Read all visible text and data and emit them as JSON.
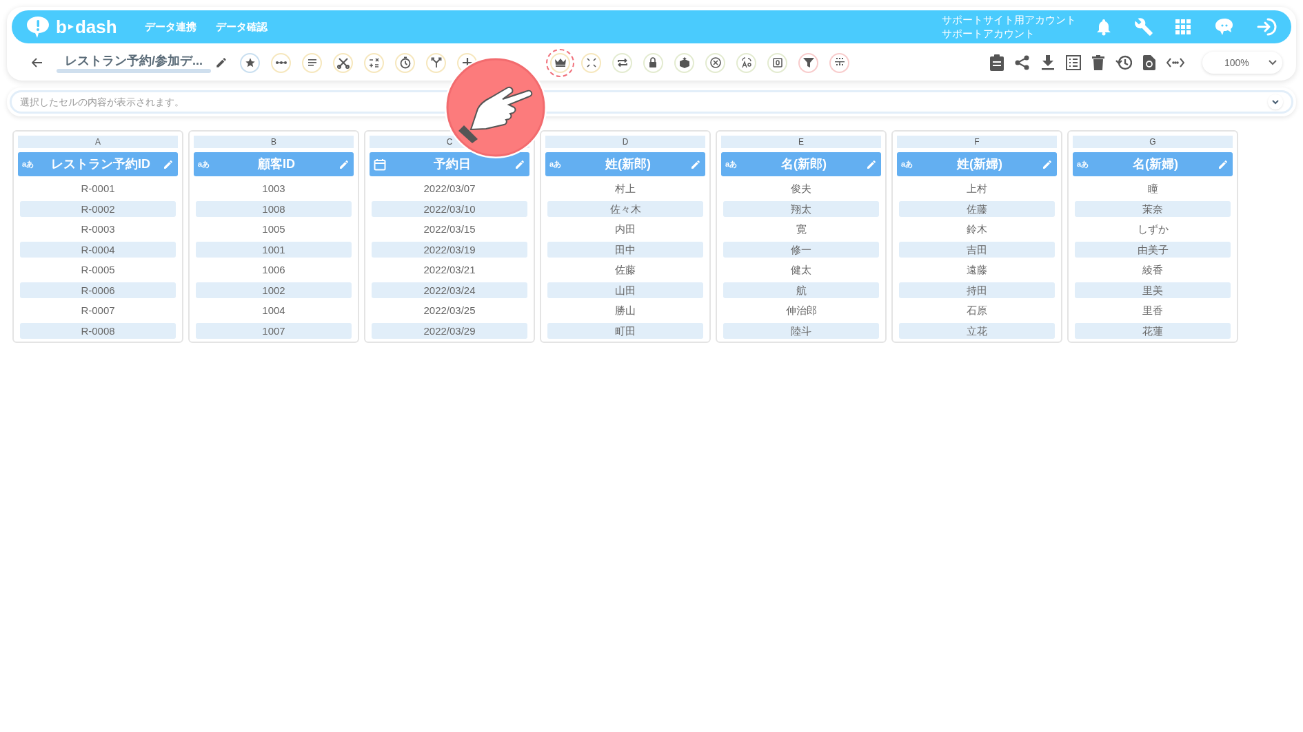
{
  "header": {
    "logo": [
      "b",
      "dash"
    ],
    "nav": [
      {
        "label": "データ連携"
      },
      {
        "label": "データ確認"
      }
    ],
    "account": [
      "サポートサイト用アカウント",
      "サポートアカウント"
    ]
  },
  "toolbar": {
    "title": "レストラン予約/参加デ...",
    "zoom": "100%"
  },
  "cell_bar": {
    "placeholder": "選択したセルの内容が表示されます。"
  },
  "columns": [
    {
      "letter": "A",
      "title": "レストラン予約ID",
      "kind": "text",
      "badge": "aあ",
      "cells": [
        "R-0001",
        "R-0002",
        "R-0003",
        "R-0004",
        "R-0005",
        "R-0006",
        "R-0007",
        "R-0008"
      ]
    },
    {
      "letter": "B",
      "title": "顧客ID",
      "kind": "text",
      "badge": "aあ",
      "cells": [
        "1003",
        "1008",
        "1005",
        "1001",
        "1006",
        "1002",
        "1004",
        "1007"
      ]
    },
    {
      "letter": "C",
      "title": "予約日",
      "kind": "date",
      "cells": [
        "2022/03/07",
        "2022/03/10",
        "2022/03/15",
        "2022/03/19",
        "2022/03/21",
        "2022/03/24",
        "2022/03/25",
        "2022/03/29"
      ]
    },
    {
      "letter": "D",
      "title": "姓(新郎)",
      "kind": "text",
      "badge": "aあ",
      "cells": [
        "村上",
        "佐々木",
        "内田",
        "田中",
        "佐藤",
        "山田",
        "勝山",
        "町田"
      ]
    },
    {
      "letter": "E",
      "title": "名(新郎)",
      "kind": "text",
      "badge": "aあ",
      "cells": [
        "俊夫",
        "翔太",
        "寛",
        "修一",
        "健太",
        "航",
        "伸治郎",
        "陸斗"
      ]
    },
    {
      "letter": "F",
      "title": "姓(新婦)",
      "kind": "text",
      "badge": "aあ",
      "cells": [
        "上村",
        "佐藤",
        "鈴木",
        "吉田",
        "遠藤",
        "持田",
        "石原",
        "立花"
      ]
    },
    {
      "letter": "G",
      "title": "名(新婦)",
      "kind": "text",
      "badge": "aあ",
      "cells": [
        "瞳",
        "茉奈",
        "しずか",
        "由美子",
        "綾香",
        "里美",
        "里香",
        "花蓮"
      ]
    }
  ]
}
